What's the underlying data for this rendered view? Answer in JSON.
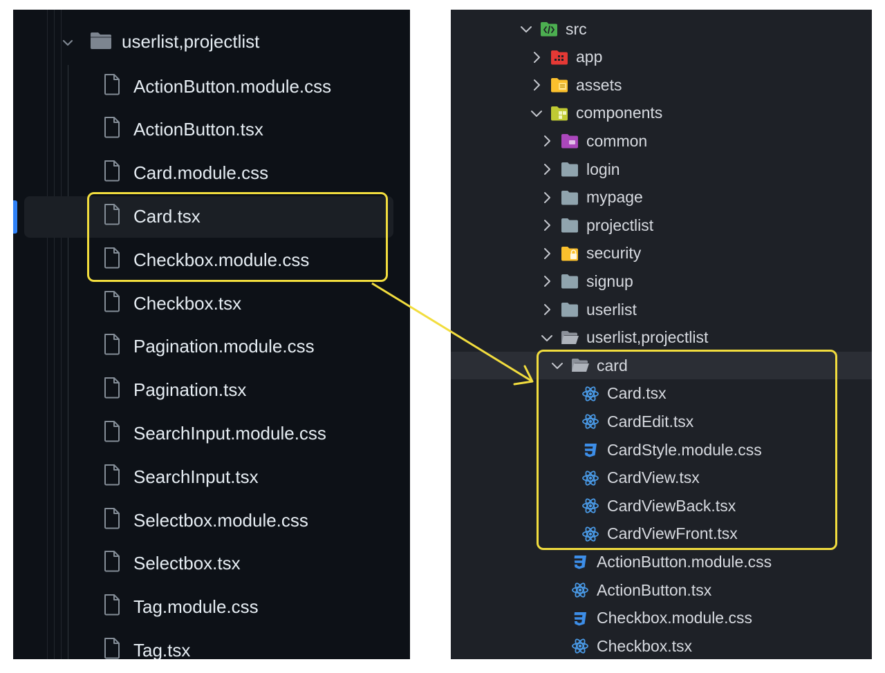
{
  "left": {
    "folder": "userlist,projectlist",
    "files": [
      "ActionButton.module.css",
      "ActionButton.tsx",
      "Card.module.css",
      "Card.tsx",
      "Checkbox.module.css",
      "Checkbox.tsx",
      "Pagination.module.css",
      "Pagination.tsx",
      "SearchInput.module.css",
      "SearchInput.tsx",
      "Selectbox.module.css",
      "Selectbox.tsx",
      "Tag.module.css",
      "Tag.tsx"
    ],
    "selected": "Card.tsx"
  },
  "right": {
    "items": [
      {
        "label": "src",
        "icon": "src-folder-icon",
        "expanded": true
      },
      {
        "label": "app",
        "icon": "app-folder-icon",
        "expanded": false
      },
      {
        "label": "assets",
        "icon": "assets-folder-icon",
        "expanded": false
      },
      {
        "label": "components",
        "icon": "components-folder-icon",
        "expanded": true
      },
      {
        "label": "common",
        "icon": "common-folder-icon",
        "expanded": false
      },
      {
        "label": "login",
        "icon": "folder-icon",
        "expanded": false
      },
      {
        "label": "mypage",
        "icon": "folder-icon",
        "expanded": false
      },
      {
        "label": "projectlist",
        "icon": "folder-icon",
        "expanded": false
      },
      {
        "label": "security",
        "icon": "security-folder-icon",
        "expanded": false
      },
      {
        "label": "signup",
        "icon": "folder-icon",
        "expanded": false
      },
      {
        "label": "userlist",
        "icon": "folder-icon",
        "expanded": false
      },
      {
        "label": "userlist,projectlist",
        "icon": "open-folder-icon",
        "expanded": true
      },
      {
        "label": "card",
        "icon": "open-folder-icon",
        "expanded": true
      },
      {
        "label": "Card.tsx",
        "icon": "react-icon"
      },
      {
        "label": "CardEdit.tsx",
        "icon": "react-icon"
      },
      {
        "label": "CardStyle.module.css",
        "icon": "css-icon"
      },
      {
        "label": "CardView.tsx",
        "icon": "react-icon"
      },
      {
        "label": "CardViewBack.tsx",
        "icon": "react-icon"
      },
      {
        "label": "CardViewFront.tsx",
        "icon": "react-icon"
      },
      {
        "label": "ActionButton.module.css",
        "icon": "css-icon"
      },
      {
        "label": "ActionButton.tsx",
        "icon": "react-icon"
      },
      {
        "label": "Checkbox.module.css",
        "icon": "css-icon"
      },
      {
        "label": "Checkbox.tsx",
        "icon": "react-icon"
      }
    ]
  },
  "colors": {
    "highlight": "#f2dd3e",
    "react": "#4a9be8",
    "css": "#3d8ee8",
    "left_bg": "#0d1117",
    "right_bg": "#1e2127"
  }
}
